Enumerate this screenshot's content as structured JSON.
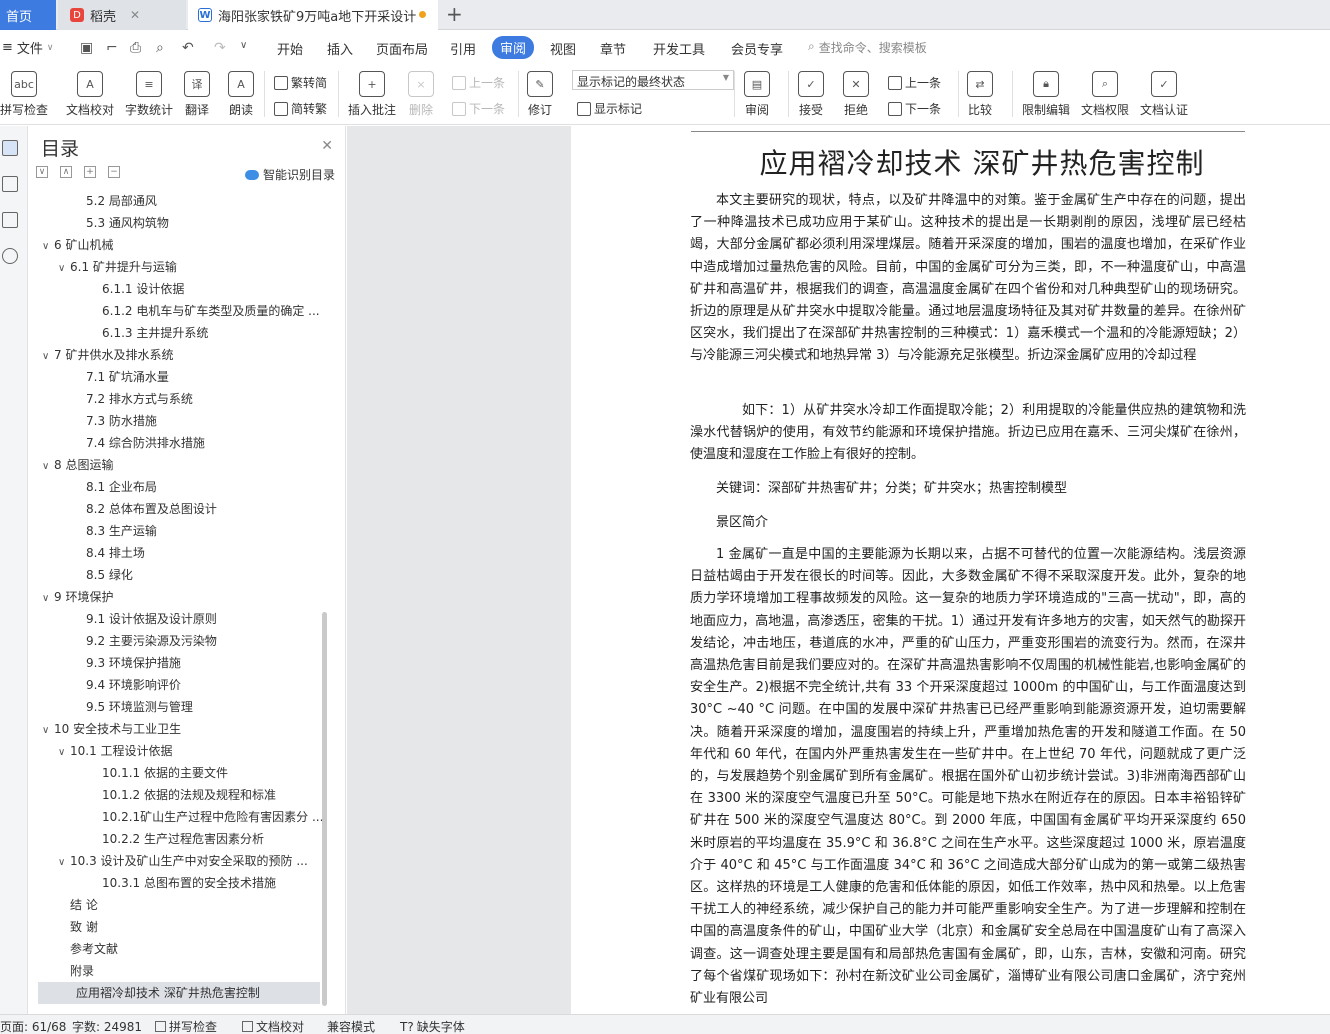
{
  "tabs": {
    "home": "首页",
    "daoke": "稻壳",
    "doc": "海阳张家铁矿9万吨a地下开采设计"
  },
  "menu": {
    "file": "文件",
    "items": [
      "开始",
      "插入",
      "页面布局",
      "引用",
      "审阅",
      "视图",
      "章节",
      "开发工具",
      "会员专享"
    ],
    "active": "审阅",
    "search": "查找命令、搜索模板"
  },
  "ribbon": {
    "spell": "拼写检查",
    "proofread": "文档校对",
    "wordcount": "字数统计",
    "translate": "翻译",
    "read": "朗读",
    "to_trad": "繁转简",
    "to_simp": "简转繁",
    "insert_comment": "插入批注",
    "delete": "删除",
    "prev": "上一条",
    "next": "下一条",
    "track": "修订",
    "markup_state": "显示标记的最终状态",
    "show_markup": "显示标记",
    "review": "审阅",
    "accept": "接受",
    "reject": "拒绝",
    "prev2": "上一条",
    "next2": "下一条",
    "compare": "比较",
    "restrict": "限制编辑",
    "permission": "文档权限",
    "certify": "文档认证"
  },
  "toc": {
    "title": "目录",
    "smart": "智能识别目录",
    "items": [
      {
        "label": "5.2  局部通风",
        "level": 2,
        "chev": ""
      },
      {
        "label": "5.3  通风构筑物",
        "level": 2,
        "chev": ""
      },
      {
        "label": "6  矿山机械",
        "level": 0,
        "chev": "∨"
      },
      {
        "label": "6.1  矿井提升与运输",
        "level": 1,
        "chev": "∨"
      },
      {
        "label": "6.1.1  设计依据",
        "level": 3,
        "chev": ""
      },
      {
        "label": "6.1.2  电机车与矿车类型及质量的确定 ...",
        "level": 3,
        "chev": ""
      },
      {
        "label": "6.1.3  主井提升系统",
        "level": 3,
        "chev": ""
      },
      {
        "label": "7  矿井供水及排水系统",
        "level": 0,
        "chev": "∨"
      },
      {
        "label": "7.1  矿坑涌水量",
        "level": 2,
        "chev": ""
      },
      {
        "label": "7.2  排水方式与系统",
        "level": 2,
        "chev": ""
      },
      {
        "label": "7.3  防水措施",
        "level": 2,
        "chev": ""
      },
      {
        "label": "7.4  综合防洪排水措施",
        "level": 2,
        "chev": ""
      },
      {
        "label": "8  总图运输",
        "level": 0,
        "chev": "∨"
      },
      {
        "label": "8.1  企业布局",
        "level": 2,
        "chev": ""
      },
      {
        "label": "8.2  总体布置及总图设计",
        "level": 2,
        "chev": ""
      },
      {
        "label": "8.3  生产运输",
        "level": 2,
        "chev": ""
      },
      {
        "label": "8.4  排土场",
        "level": 2,
        "chev": ""
      },
      {
        "label": "8.5  绿化",
        "level": 2,
        "chev": ""
      },
      {
        "label": "9  环境保护",
        "level": 0,
        "chev": "∨"
      },
      {
        "label": "9.1  设计依据及设计原则",
        "level": 2,
        "chev": ""
      },
      {
        "label": "9.2  主要污染源及污染物",
        "level": 2,
        "chev": ""
      },
      {
        "label": "9.3  环境保护措施",
        "level": 2,
        "chev": ""
      },
      {
        "label": "9.4  环境影响评价",
        "level": 2,
        "chev": ""
      },
      {
        "label": "9.5  环境监测与管理",
        "level": 2,
        "chev": ""
      },
      {
        "label": "10  安全技术与工业卫生",
        "level": 0,
        "chev": "∨"
      },
      {
        "label": "10.1  工程设计依据",
        "level": 1,
        "chev": "∨"
      },
      {
        "label": "10.1.1  依据的主要文件",
        "level": 3,
        "chev": ""
      },
      {
        "label": "10.1.2  依据的法规及规程和标准",
        "level": 3,
        "chev": ""
      },
      {
        "label": "10.2.1矿山生产过程中危险有害因素分 ...",
        "level": 3,
        "chev": ""
      },
      {
        "label": "10.2.2  生产过程危害因素分析",
        "level": 3,
        "chev": ""
      },
      {
        "label": "10.3  设计及矿山生产中对安全采取的预防 ...",
        "level": 1,
        "chev": "∨"
      },
      {
        "label": "10.3.1  总图布置的安全技术措施",
        "level": 3,
        "chev": ""
      },
      {
        "label": "结      论",
        "level": 4,
        "chev": ""
      },
      {
        "label": "致      谢",
        "level": 4,
        "chev": ""
      },
      {
        "label": "参考文献",
        "level": 4,
        "chev": ""
      },
      {
        "label": "附录",
        "level": 4,
        "chev": ""
      },
      {
        "label": "应用褶冷却技术  深矿井热危害控制",
        "level": 5,
        "chev": ""
      }
    ]
  },
  "doc": {
    "title": "应用褶冷却技术  深矿井热危害控制",
    "p1": "本文主要研究的现状，特点，以及矿井降温中的对策。鉴于金属矿生产中存在的问题，提出了一种降温技术已成功应用于某矿山。这种技术的提出是一长期剥削的原因，浅埋矿层已经枯竭，大部分金属矿都必须利用深埋煤层。随着开采深度的增加，围岩的温度也增加，在采矿作业中造成增加过量热危害的风险。目前，中国的金属矿可分为三类，即，不一种温度矿山，中高温矿井和高温矿井，根据我们的调查，高温温度金属矿在四个省份和对几种典型矿山的现场研究。折边的原理是从矿井突水中提取冷能量。通过地层温度场特征及其对矿井数量的差异。在徐州矿区突水，我们提出了在深部矿井热害控制的三种模式：1）嘉禾模式一个温和的冷能源短缺；2）与冷能源三河尖模式和地热异常 3）与冷能源充足张模型。折边深金属矿应用的冷却过程",
    "p2": "如下：1）从矿井突水冷却工作面提取冷能；2）利用提取的冷能量供应热的建筑物和洗澡水代替锅炉的使用，有效节约能源和环境保护措施。折边已应用在嘉禾、三河尖煤矿在徐州，使温度和湿度在工作脸上有很好的控制。",
    "keywords": "关键词：深部矿井热害矿井；分类；矿井突水；热害控制模型",
    "scenic": "景区简介",
    "p3": "1 金属矿一直是中国的主要能源为长期以来，占据不可替代的位置一次能源结构。浅层资源日益枯竭由于开发在很长的时间等。因此，大多数金属矿不得不采取深度开发。此外，复杂的地质力学环境增加工程事故频发的风险。这一复杂的地质力学环境造成的\"三高一扰动\"，即，高的地面应力，高地温，高渗透压，密集的干扰。1）通过开发有许多地方的灾害，如天然气的勘探开发结论，冲击地压，巷道底的水冲，严重的矿山压力，严重变形围岩的流变行为。然而，在深井高温热危害目前是我们要应对的。在深矿井高温热害影响不仅周围的机械性能岩,也影响金属矿的安全生产。2)根据不完全统计,共有 33 个开采深度超过 1000m 的中国矿山，与工作面温度达到 30°C ~40 °C 问题。在中国的发展中深矿井热害已已经严重影响到能源资源开发，迫切需要解决。随着开采深度的增加，温度围岩的持续上升，严重增加热危害的开发和隧道工作面。在 50 年代和 60 年代，在国内外严重热害发生在一些矿井中。在上世纪 70 年代，问题就成了更广泛的，与发展趋势个别金属矿到所有金属矿。根据在国外矿山初步统计尝试。3)非洲南海西部矿山在 3300 米的深度空气温度已升至 50°C。可能是地下热水在附近存在的原因。日本丰裕铅锌矿矿井在 500 米的深度空气温度达 80°C。到 2000 年底，中国国有金属矿平均开采深度约 650 米时原岩的平均温度在 35.9°C 和 36.8°C 之间在生产水平。这些深度超过 1000 米，原岩温度介于 40°C 和 45°C 与工作面温度 34°C 和 36°C 之间造成大部分矿山成为的第一或第二级热害区。这样热的环境是工人健康的危害和低体能的原因，如低工作效率，热中风和热晕。以上危害干扰工人的神经系统，减少保护自己的能力并可能严重影响安全生产。为了进一步理解和控制在中国的高温度条件的矿山，中国矿业大学（北京）和金属矿安全总局在中国温度矿山有了高深入调查。这一调查处理主要是国有和局部热危害国有金属矿，即，山东，吉林，安徽和河南。研究了每个省煤矿现场如下：孙村在新汶矿业公司金属矿，淄博矿业有限公司唐口金属矿，济宁兖州矿业有限公司"
  },
  "status": {
    "page": "页面: 61/68",
    "words": "字数: 24981",
    "spell": "拼写检查",
    "proof": "文档校对",
    "compat": "兼容模式",
    "font": "缺失字体"
  }
}
